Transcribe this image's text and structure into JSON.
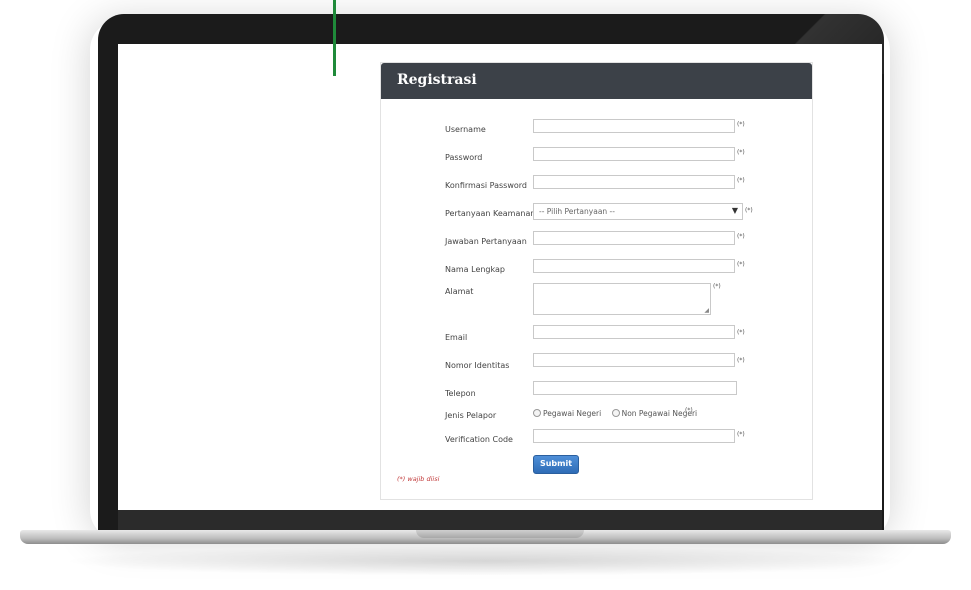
{
  "panel": {
    "title": "Registrasi"
  },
  "required_mark": "(*)",
  "fields": [
    {
      "label": "Username",
      "value": "",
      "required": true
    },
    {
      "label": "Password",
      "value": "",
      "required": true
    },
    {
      "label": "Konfirmasi Password",
      "value": "",
      "required": true
    },
    {
      "label": "Pertanyaan Keamanan",
      "value": "",
      "required": true
    },
    {
      "label": "Jawaban Pertanyaan",
      "value": "",
      "required": true
    },
    {
      "label": "Nama Lengkap",
      "value": "",
      "required": true
    },
    {
      "label": "Alamat",
      "value": "",
      "required": true
    },
    {
      "label": "Email",
      "value": "",
      "required": true
    },
    {
      "label": "Nomor Identitas",
      "value": "",
      "required": true
    },
    {
      "label": "Telepon",
      "value": "",
      "required": false
    },
    {
      "label": "Jenis Pelapor",
      "required": true
    },
    {
      "label": "Verification Code",
      "value": "",
      "required": true
    }
  ],
  "security_select": {
    "selected": "-- Pilih Pertanyaan --"
  },
  "reporter_type_options": [
    "Pegawai Negeri",
    "Non Pegawai Negeri"
  ],
  "submit_label": "Submit",
  "required_note": "(*) wajib diisi",
  "colors": {
    "header_bg": "#3c4148",
    "submit_bg": "#2e6cb6",
    "accent_line": "#1f8a3a",
    "required_note": "#c23b3b"
  }
}
